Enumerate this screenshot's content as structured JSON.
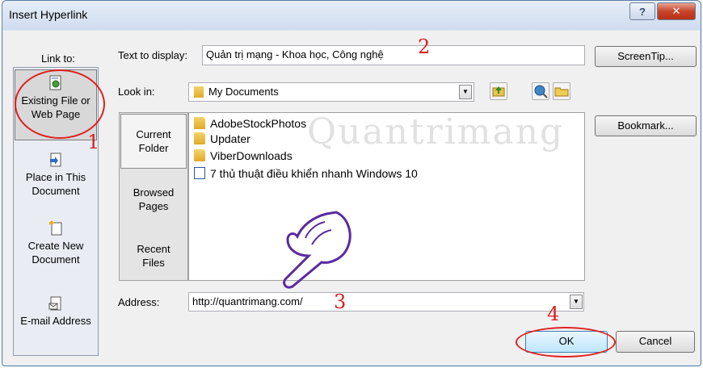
{
  "window": {
    "title": "Insert Hyperlink",
    "help_label": "?",
    "close_label": "✕"
  },
  "link_to": {
    "header": "Link to:",
    "items": [
      {
        "line1": "Existing File or",
        "line2": "Web Page",
        "icon": "globe-file-icon",
        "selected": true
      },
      {
        "line1": "Place in This",
        "line2": "Document",
        "icon": "document-place-icon",
        "selected": false
      },
      {
        "line1": "Create New",
        "line2": "Document",
        "icon": "new-document-icon",
        "selected": false
      },
      {
        "line1": "E-mail Address",
        "line2": "",
        "icon": "email-icon",
        "selected": false
      }
    ]
  },
  "text_to_display": {
    "label": "Text to display:",
    "value": "Quản trị mạng - Khoa học, Công nghệ"
  },
  "screentip_label": "ScreenTip...",
  "look_in": {
    "label": "Look in:",
    "value": "My Documents"
  },
  "nav": [
    {
      "line1": "Current",
      "line2": "Folder",
      "selected": true
    },
    {
      "line1": "Browsed",
      "line2": "Pages",
      "selected": false
    },
    {
      "line1": "Recent",
      "line2": "Files",
      "selected": false
    }
  ],
  "files": [
    {
      "name": "AdobeStockPhotos",
      "type": "folder"
    },
    {
      "name": "Updater",
      "type": "folder"
    },
    {
      "name": "ViberDownloads",
      "type": "folder"
    },
    {
      "name": "7 thủ thuật điều khiển nhanh Windows 10",
      "type": "word"
    }
  ],
  "bookmark_label": "Bookmark...",
  "address": {
    "label": "Address:",
    "value": "http://quantrimang.com/"
  },
  "ok_label": "OK",
  "cancel_label": "Cancel",
  "annotations": [
    "1",
    "2",
    "3",
    "4"
  ],
  "watermark": "Quantrimang",
  "colors": {
    "annotation_red": "#d82020",
    "dialog_frame": "#dbe5f1"
  }
}
